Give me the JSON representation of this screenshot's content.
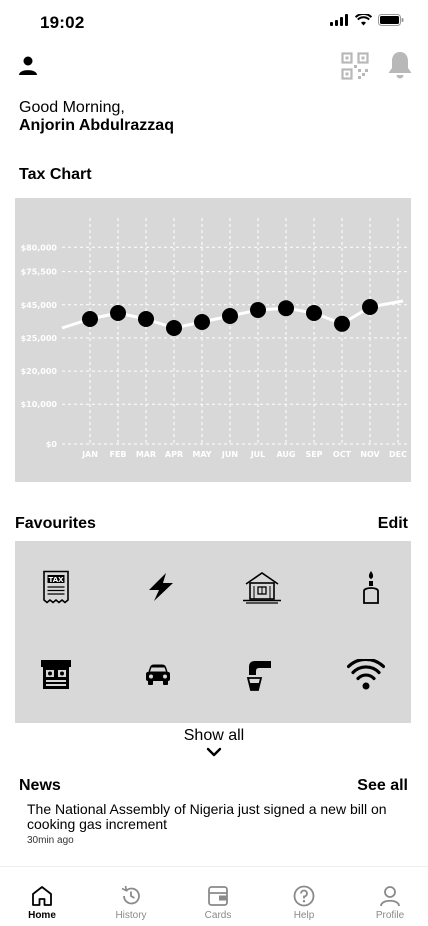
{
  "status_bar": {
    "time": "19:02",
    "icons": [
      "signal-icon",
      "wifi-icon",
      "battery-icon"
    ]
  },
  "header": {
    "greeting": "Good Morning,",
    "user_name": "Anjorin Abdulrazzaq",
    "icons": [
      "person-icon",
      "qr-code-icon",
      "bell-icon"
    ]
  },
  "tax_chart": {
    "title": "Tax Chart"
  },
  "chart_data": {
    "type": "line",
    "title": "Tax Chart",
    "xlabel": "",
    "ylabel": "",
    "categories": [
      "JAN",
      "FEB",
      "MAR",
      "APR",
      "MAY",
      "JUN",
      "JUL",
      "AUG",
      "SEP",
      "OCT",
      "NOV",
      "DEC"
    ],
    "y_tick_labels": [
      "$0",
      "$10,000",
      "$20,000",
      "$25,000",
      "$45,000",
      "$75,500",
      "$80,000"
    ],
    "series": [
      {
        "values": [
          4,
          5,
          4,
          2.5,
          3.5,
          4.5,
          5.5,
          5.8,
          5,
          3.2,
          6,
          null
        ]
      }
    ],
    "trend_line": {
      "start": 2.5,
      "end": 7
    },
    "grid": true,
    "colors": {
      "panel": "#d8d8d8",
      "line": "#ffffff",
      "points": "#000000",
      "grid": "#ffffff"
    }
  },
  "favourites": {
    "title": "Favourites",
    "edit_label": "Edit",
    "items": [
      {
        "icon": "tax-receipt-icon"
      },
      {
        "icon": "electricity-bolt-icon"
      },
      {
        "icon": "house-icon"
      },
      {
        "icon": "gas-cylinder-icon"
      },
      {
        "icon": "market-stall-icon"
      },
      {
        "icon": "car-icon"
      },
      {
        "icon": "water-tap-icon"
      },
      {
        "icon": "wifi-icon"
      }
    ],
    "show_all_label": "Show all"
  },
  "news": {
    "title": "News",
    "see_all_label": "See all",
    "items": [
      {
        "headline": "The National Assembly of Nigeria just signed a new bill on cooking gas increment",
        "time": "30min ago"
      }
    ]
  },
  "tab_bar": {
    "tabs": [
      {
        "label": "Home",
        "icon": "home-icon",
        "active": true
      },
      {
        "label": "History",
        "icon": "history-icon",
        "active": false
      },
      {
        "label": "Cards",
        "icon": "wallet-icon",
        "active": false
      },
      {
        "label": "Help",
        "icon": "help-icon",
        "active": false
      },
      {
        "label": "Profile",
        "icon": "profile-icon",
        "active": false
      }
    ]
  }
}
